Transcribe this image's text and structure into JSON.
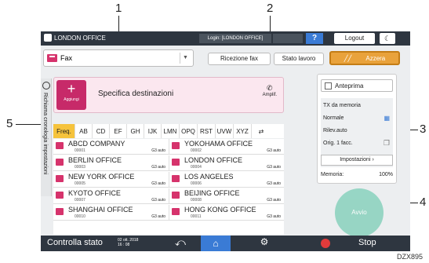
{
  "callouts": [
    "1",
    "2",
    "3",
    "4",
    "5"
  ],
  "topbar": {
    "user_label": "LONDON OFFICE",
    "login_text": "Login: [LONDON OFFICE]",
    "help_label": "?",
    "logout_label": "Logout",
    "theme_icon": "moon-icon"
  },
  "function_select": {
    "value": "Fax"
  },
  "buttons": {
    "fax_reception": "Ricezione fax",
    "job_status": "Stato lavoro",
    "reset": "Azzera"
  },
  "side_tab": {
    "label": "Richiama cronologia impostazioni"
  },
  "destination": {
    "add_label": "Aggiungi",
    "title": "Specifica destinazioni",
    "ampl_label": "Amplif."
  },
  "tabs": [
    "Freq.",
    "AB",
    "CD",
    "EF",
    "GH",
    "IJK",
    "LMN",
    "OPQ",
    "RST",
    "UVW",
    "XYZ"
  ],
  "destinations": [
    {
      "name": "ABCD COMPANY",
      "number": "00001",
      "mode": "G3 auto"
    },
    {
      "name": "YOKOHAMA OFFICE",
      "number": "00002",
      "mode": "G3 auto"
    },
    {
      "name": "BERLIN OFFICE",
      "number": "00003",
      "mode": "G3 auto"
    },
    {
      "name": "LONDON OFFICE",
      "number": "00004",
      "mode": "G3 auto"
    },
    {
      "name": "NEW YORK OFFICE",
      "number": "00005",
      "mode": "G3 auto"
    },
    {
      "name": "LOS ANGELES",
      "number": "00006",
      "mode": "G3 auto"
    },
    {
      "name": "KYOTO OFFICE",
      "number": "00007",
      "mode": "G3 auto"
    },
    {
      "name": "BEIJING OFFICE",
      "number": "00008",
      "mode": "G3 auto"
    },
    {
      "name": "SHANGHAI  OFFICE",
      "number": "00010",
      "mode": "G3 auto"
    },
    {
      "name": "HONG KONG OFFICE",
      "number": "00011",
      "mode": "G3 auto"
    }
  ],
  "settings_panel": {
    "preview": "Anteprima",
    "tx_memory": "TX da memoria",
    "normal": "Normale",
    "detect_auto": "Rilev.auto",
    "orig_face": "Orig. 1 facc.",
    "impostazioni": "Impostazioni",
    "memory_label": "Memoria:",
    "memory_value": "100%"
  },
  "start_label": "Avvio",
  "bottombar": {
    "status_check": "Controlla stato",
    "date": "02 ott. 2018",
    "time": "16 : 08",
    "stop_label": "Stop"
  },
  "doc_code": "DZX895"
}
